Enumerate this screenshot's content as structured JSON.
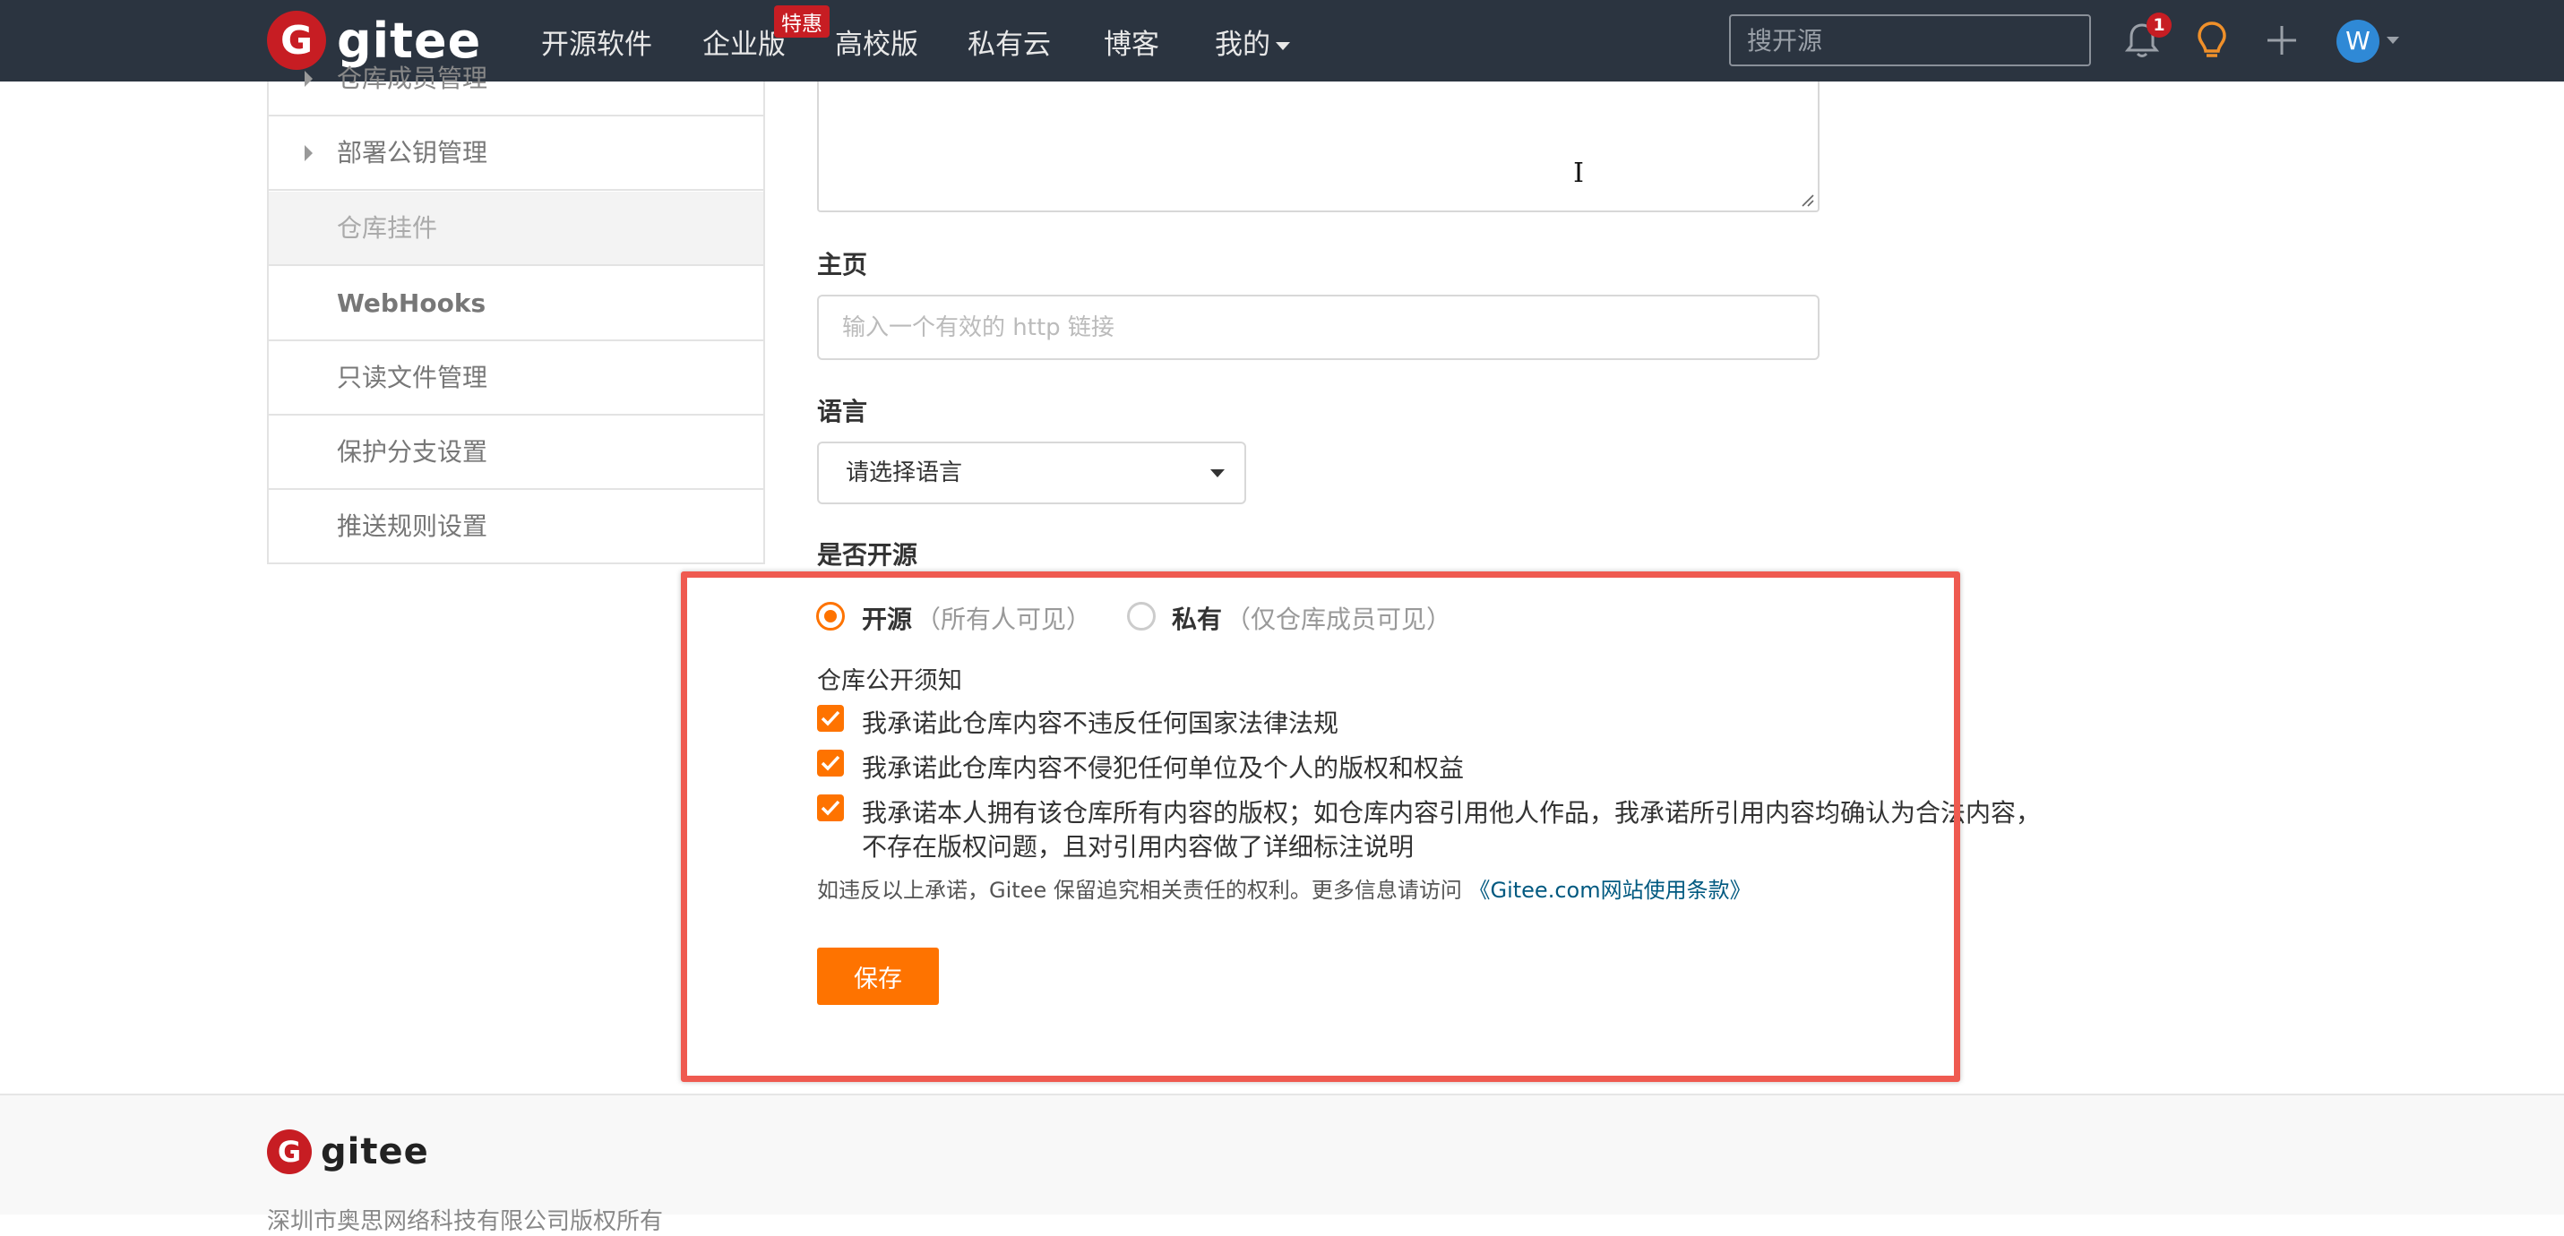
{
  "navbar": {
    "logo_text": "gitee",
    "items": [
      "开源软件",
      "企业版",
      "高校版",
      "私有云",
      "博客",
      "我的"
    ],
    "enterprise_badge": "特惠",
    "search_placeholder": "搜开源",
    "notification_count": "1",
    "avatar_letter": "W"
  },
  "sidebar": {
    "items": [
      "仓库成员管理",
      "部署公钥管理",
      "仓库挂件",
      "WebHooks",
      "只读文件管理",
      "保护分支设置",
      "推送规则设置"
    ]
  },
  "form": {
    "homepage_label": "主页",
    "homepage_placeholder": "输入一个有效的 http 链接",
    "language_label": "语言",
    "language_value": "请选择语言",
    "opensource_label": "是否开源",
    "radio_public_label": "开源",
    "radio_public_hint": "（所有人可见）",
    "radio_private_label": "私有",
    "radio_private_hint": "（仅仓库成员可见）",
    "notice_title": "仓库公开须知",
    "pledges": [
      "我承诺此仓库内容不违反任何国家法律法规",
      "我承诺此仓库内容不侵犯任何单位及个人的版权和权益",
      "我承诺本人拥有该仓库所有内容的版权；如仓库内容引用他人作品，我承诺所引用内容均确认为合法内容，",
      "不存在版权问题，且对引用内容做了详细标注说明"
    ],
    "footnote_text": "如违反以上承诺，Gitee 保留追究相关责任的权利。更多信息请访问",
    "footnote_link": "《Gitee.com网站使用条款》",
    "save_label": "保存"
  },
  "footer": {
    "logo_text": "gitee",
    "copyright": "深圳市奥思网络科技有限公司版权所有"
  },
  "colors": {
    "navbar_bg": "#2b3440",
    "brand_red": "#c71d23",
    "accent_orange": "#fe7300",
    "annotation_red": "#ef5a50",
    "link_blue": "#005980"
  }
}
